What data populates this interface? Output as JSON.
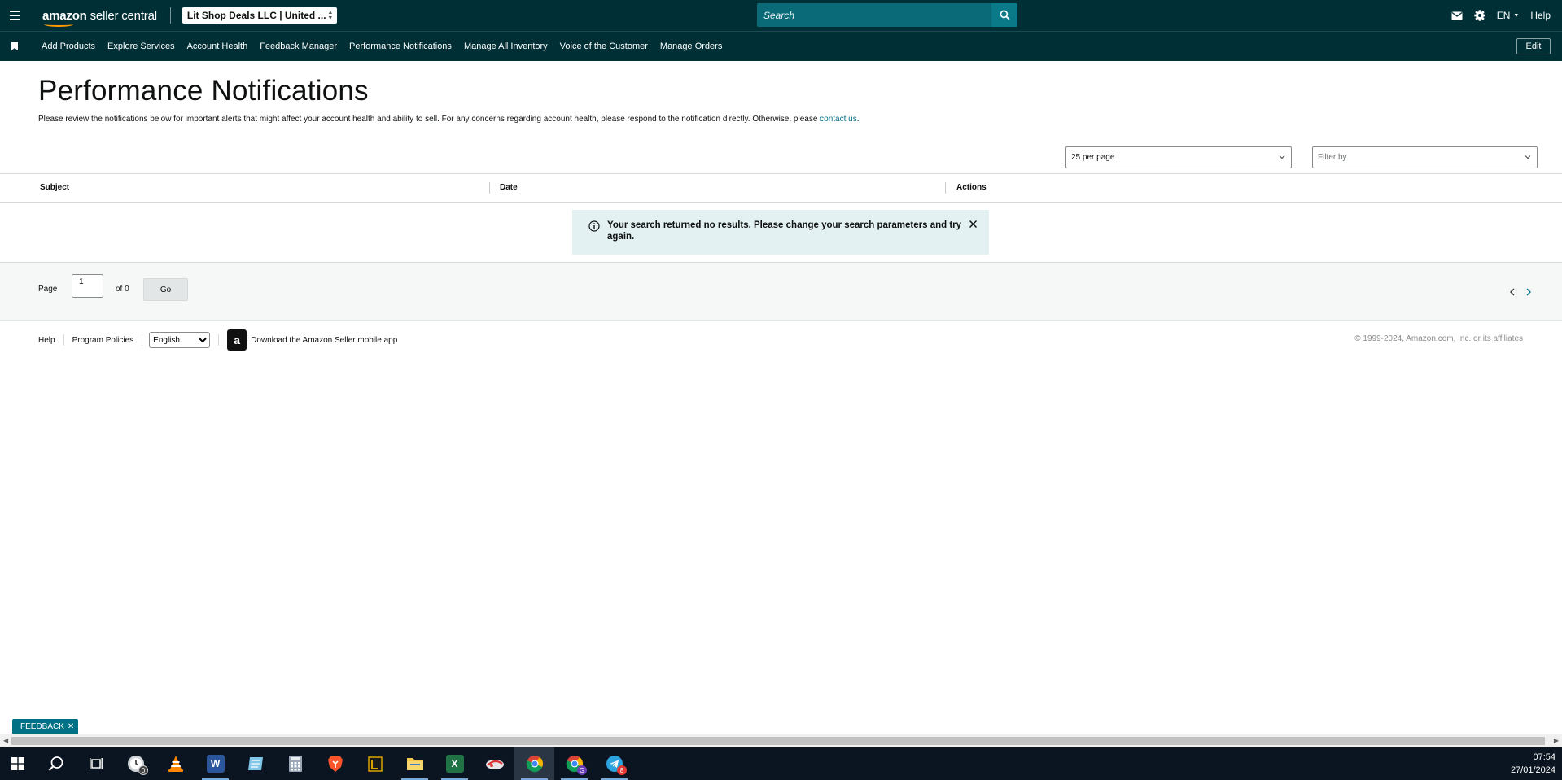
{
  "header": {
    "logo_brand": "amazon",
    "logo_product": "seller central",
    "account": "Lit Shop Deals LLC | United ...",
    "search_placeholder": "Search",
    "language": "EN",
    "help": "Help"
  },
  "nav": {
    "items": [
      {
        "label": "Add Products"
      },
      {
        "label": "Explore Services"
      },
      {
        "label": "Account Health"
      },
      {
        "label": "Feedback Manager"
      },
      {
        "label": "Performance Notifications"
      },
      {
        "label": "Manage All Inventory"
      },
      {
        "label": "Voice of the Customer"
      },
      {
        "label": "Manage Orders"
      }
    ],
    "edit": "Edit"
  },
  "main": {
    "title": "Performance Notifications",
    "description": "Please review the notifications below for important alerts that might affect your account health and ability to sell. For any concerns regarding account health, please respond to the notification directly. Otherwise, please ",
    "contact_link": "contact us",
    "description_end": ".",
    "per_page": "25 per page",
    "filter_placeholder": "Filter by"
  },
  "table": {
    "columns": [
      "Subject",
      "Date",
      "Actions"
    ],
    "empty_message": "Your search returned no results. Please change your search parameters and try again."
  },
  "pager": {
    "page_label": "Page",
    "current_page": "1",
    "of_label": "of 0",
    "go": "Go"
  },
  "footer": {
    "help": "Help",
    "program_policies": "Program Policies",
    "language_selected": "English",
    "app_download": "Download the Amazon Seller mobile app",
    "copyright": "© 1999-2024, Amazon.com, Inc. or its affiliates"
  },
  "feedback_tab": "FEEDBACK",
  "taskbar": {
    "time": "07:54",
    "date": "27/01/2024",
    "icons": [
      {
        "name": "windows-start-icon"
      },
      {
        "name": "search-icon"
      },
      {
        "name": "task-view-icon"
      },
      {
        "name": "clock-app-icon",
        "badge": "0"
      },
      {
        "name": "vlc-icon"
      },
      {
        "name": "word-icon",
        "letter": "W",
        "color": "#2b579a"
      },
      {
        "name": "notepad-icon"
      },
      {
        "name": "calculator-icon"
      },
      {
        "name": "brave-icon"
      },
      {
        "name": "media-app-icon"
      },
      {
        "name": "file-explorer-icon"
      },
      {
        "name": "excel-icon",
        "letter": "X",
        "color": "#217346"
      },
      {
        "name": "cloud-app-icon"
      },
      {
        "name": "chrome-icon"
      },
      {
        "name": "chrome-profile-icon",
        "badge": "G"
      },
      {
        "name": "telegram-icon",
        "badge": "8"
      }
    ]
  },
  "colors": {
    "header_bg": "#002f36",
    "search_bg": "#0a6a77",
    "link": "#007185",
    "alert_bg": "#e3f1f2",
    "brand_orange": "#ff9900"
  }
}
